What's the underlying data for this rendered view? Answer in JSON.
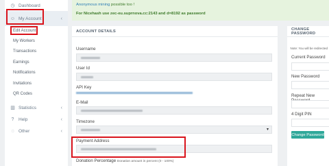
{
  "sidebar": {
    "items": [
      {
        "label": "Dashboard",
        "icon": "dashboard-icon",
        "glyph": "◷"
      },
      {
        "label": "My Account",
        "icon": "user-icon",
        "glyph": "☺",
        "chevron": "‹"
      },
      {
        "label": "Statistics",
        "icon": "statistics-icon",
        "glyph": "▥",
        "chevron": "‹"
      },
      {
        "label": "Help",
        "icon": "help-icon",
        "glyph": "?",
        "chevron": "‹"
      },
      {
        "label": "Other",
        "icon": "other-icon",
        "glyph": "◌",
        "chevron": "‹"
      }
    ],
    "subitems": [
      "Edit Account",
      "My Workers",
      "Transactions",
      "Earnings",
      "Notifications",
      "Invitations",
      "QR Codes"
    ]
  },
  "notice": {
    "highlight": "Anonymous mining",
    "line1_rest": " possible too !",
    "line2": "For Nicehash use zec-eu.suprnova.cc:2143 and d=8192 as password"
  },
  "account": {
    "title": "ACCOUNT DETAILS",
    "fields": {
      "username": "Username",
      "user_id": "User Id",
      "api_key": "API Key",
      "email": "E-Mail",
      "timezone": "Timezone",
      "payment_address": "Payment Address",
      "donation": "Donation Percentage"
    },
    "donation_hint": "Donation amount in percent (0 - 100%)",
    "select_arrow": "▾"
  },
  "password": {
    "title": "CHANGE PASSWORD",
    "note": "Note: You will be redirected",
    "current": "Current Password",
    "new": "New Password",
    "repeat": "Repeat New Password",
    "pin": "4 Digit PIN",
    "button": "Change Password"
  },
  "colors": {
    "highlight_red": "#d9131b",
    "button_teal": "#2fa89a",
    "notice_bg": "#e6f3de"
  }
}
